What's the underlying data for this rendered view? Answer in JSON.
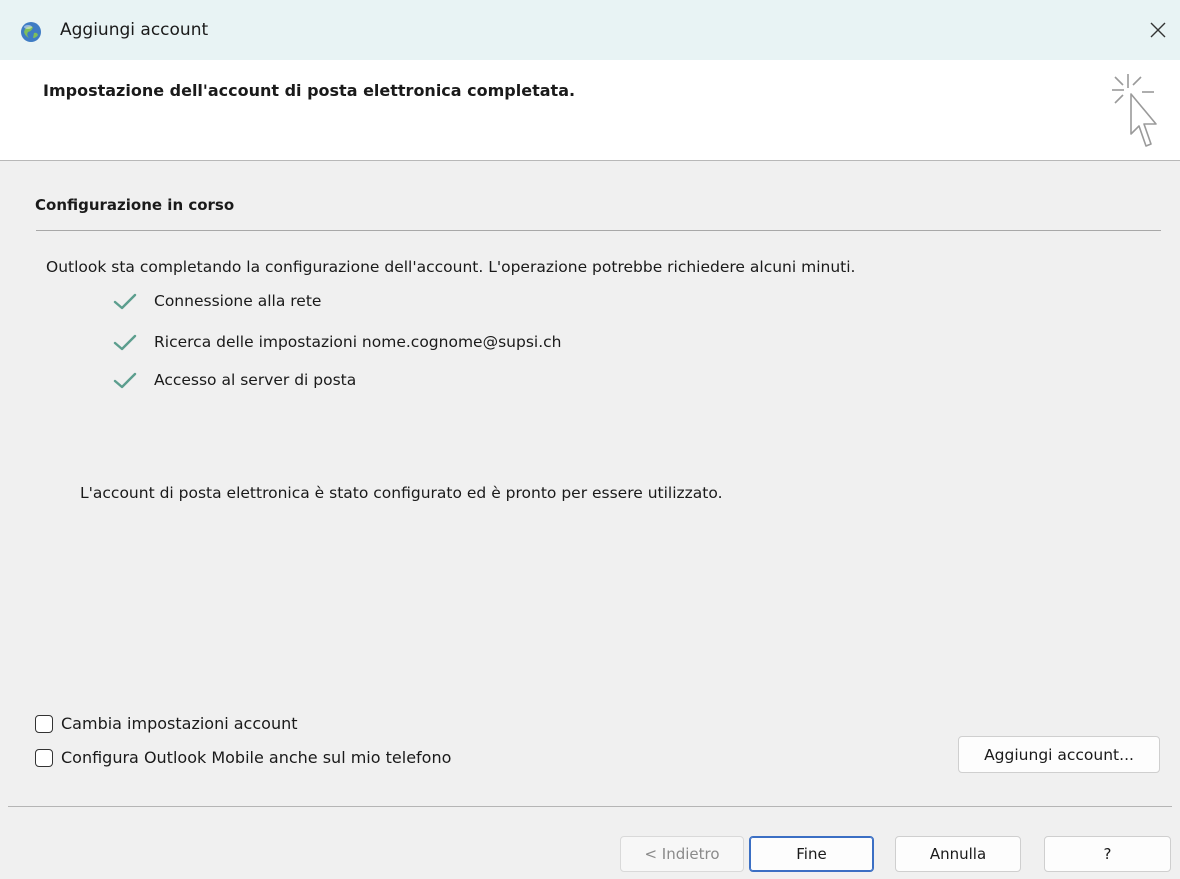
{
  "window": {
    "title": "Aggiungi account",
    "close_label": "×"
  },
  "header": {
    "title": "Impostazione dell'account di posta elettronica completata."
  },
  "section": {
    "title": "Configurazione in corso",
    "intro": "Outlook sta completando la configurazione dell'account. L'operazione potrebbe richiedere alcuni minuti.",
    "steps": [
      {
        "label": "Connessione alla rete",
        "status": "done"
      },
      {
        "label": "Ricerca delle impostazioni nome.cognome@supsi.ch",
        "status": "done"
      },
      {
        "label": "Accesso al server di posta",
        "status": "done"
      }
    ],
    "done_message": "L'account di posta elettronica è stato configurato ed è pronto per essere utilizzato."
  },
  "options": {
    "change_settings": {
      "label": "Cambia impostazioni account",
      "checked": false
    },
    "mobile_setup": {
      "label": "Configura Outlook Mobile anche sul mio telefono",
      "checked": false
    }
  },
  "buttons": {
    "add_account": "Aggiungi account...",
    "back": "< Indietro",
    "finish": "Fine",
    "cancel": "Annulla",
    "help": "?"
  },
  "colors": {
    "titlebar": "#e8f3f4",
    "check": "#5c9e8e",
    "primary_border": "#3b6fc4"
  }
}
